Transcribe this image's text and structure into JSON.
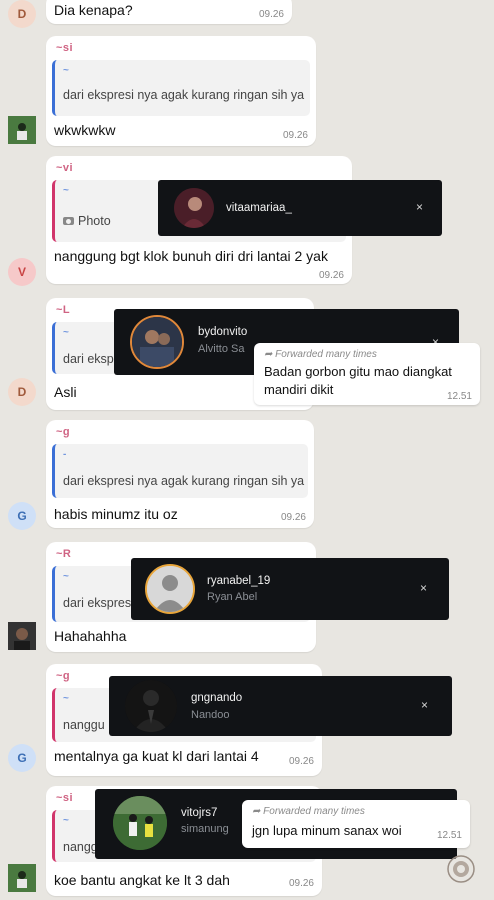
{
  "colors": {
    "background": "#e8e6e1",
    "bubble": "#ffffff",
    "quote_bar_blue": "#3b6fd6",
    "quote_bar_pink": "#d1356b",
    "overlay": "#111316"
  },
  "messages": [
    {
      "avatar_letter": "D",
      "text": "Dia kenapa?",
      "time": "09.26"
    },
    {
      "sender": "~si",
      "quote_sender": "~",
      "quote_text": "dari ekspresi nya agak kurang ringan sih ya",
      "text": "wkwkwkw",
      "time": "09.26"
    },
    {
      "sender": "~vi",
      "quote_sender": "~",
      "quote_text": "Photo",
      "avatar_letter": "V",
      "text": "nanggung bgt klok bunuh diri dri lantai 2 yak",
      "time": "09.26"
    },
    {
      "sender": "~L",
      "quote_sender": "~",
      "quote_text": "dari eksp",
      "avatar_letter": "D",
      "text": "Asli"
    },
    {
      "sender": "~g",
      "quote_sender": "-",
      "quote_text": "dari ekspresi nya agak kurang ringan sih ya",
      "avatar_letter": "G",
      "text": "habis minumz itu oz",
      "time": "09.26"
    },
    {
      "sender": "~R",
      "quote_sender": "~",
      "quote_text": "dari ekspres",
      "text": "Hahahahha"
    },
    {
      "sender": "~g",
      "quote_sender": "~",
      "quote_text": "nanggu",
      "avatar_letter": "G",
      "text": "mentalnya ga kuat kl dari lantai 4",
      "time": "09.26"
    },
    {
      "sender": "~si",
      "quote_sender": "~",
      "quote_text": "nangg",
      "text": "koe bantu angkat ke lt 3 dah",
      "time": "09.26"
    }
  ],
  "stories": [
    {
      "username": "vitaamariaa_",
      "close": "×"
    },
    {
      "username": "bydonvito",
      "fullname": "Alvitto Sa",
      "close": "×",
      "forward_label": "Forwarded many times",
      "forward_text": "Badan gorbon gitu mao diangkat mandiri dikit",
      "forward_time": "12.51"
    },
    {
      "username": "ryanabel_19",
      "fullname": "Ryan Abel",
      "close": "×"
    },
    {
      "username": "gngnando",
      "fullname": "Nandoo",
      "close": "×"
    },
    {
      "username": "vitojrs7",
      "fullname": "simanung",
      "forward_label": "Forwarded many times",
      "forward_text": "jgn lupa minum sanax woi",
      "forward_time": "12.51"
    }
  ]
}
